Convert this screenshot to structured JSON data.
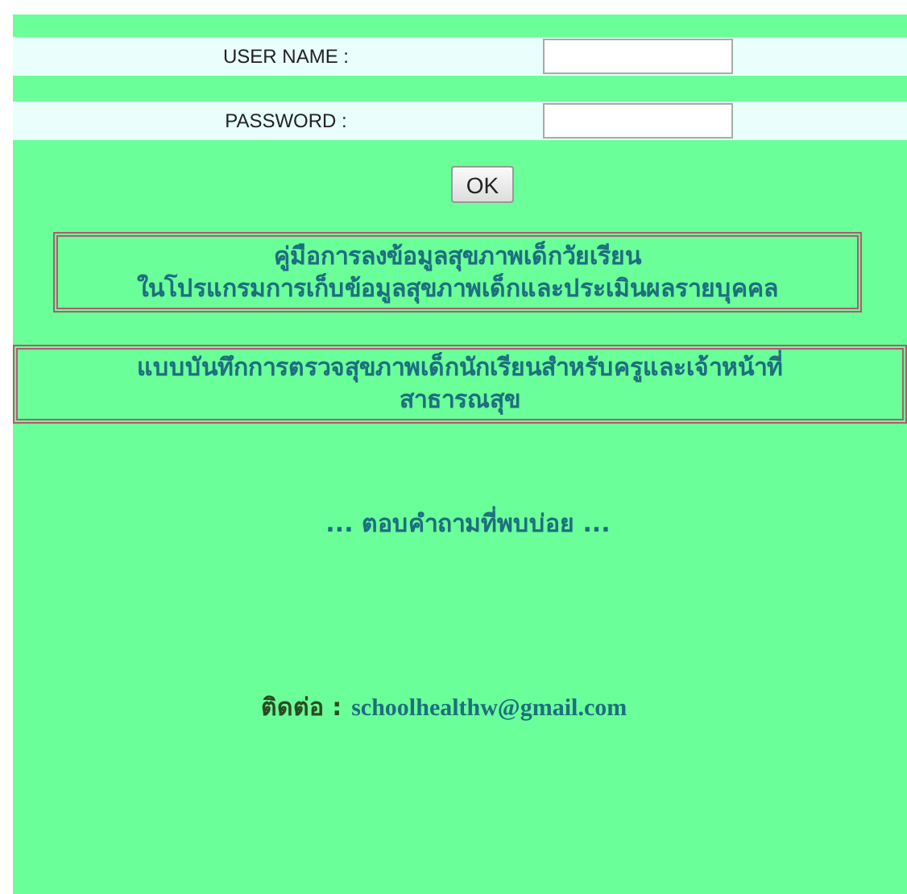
{
  "login": {
    "fields": [
      {
        "label": "USER NAME :"
      },
      {
        "label": "PASSWORD :"
      }
    ],
    "button": "OK"
  },
  "links": [
    {
      "lines": [
        "คู่มือการลงข้อมูลสุขภาพเด็กวัยเรียน",
        "ในโปรแกรมการเก็บข้อมูลสุขภาพเด็กและประเมินผลรายบุคคล"
      ],
      "kind": "narrow"
    },
    {
      "lines": [
        "แบบบันทึกการตรวจสุขภาพเด็กนักเรียนสำหรับครูและเจ้าหน้าที่",
        "สาธารณสุข"
      ],
      "kind": "wide"
    }
  ],
  "faq": "... ตอบคำถามที่พบบ่อย ...",
  "contact": {
    "label": "ติดต่อ :",
    "email": "schoolhealthw@gmail.com"
  }
}
